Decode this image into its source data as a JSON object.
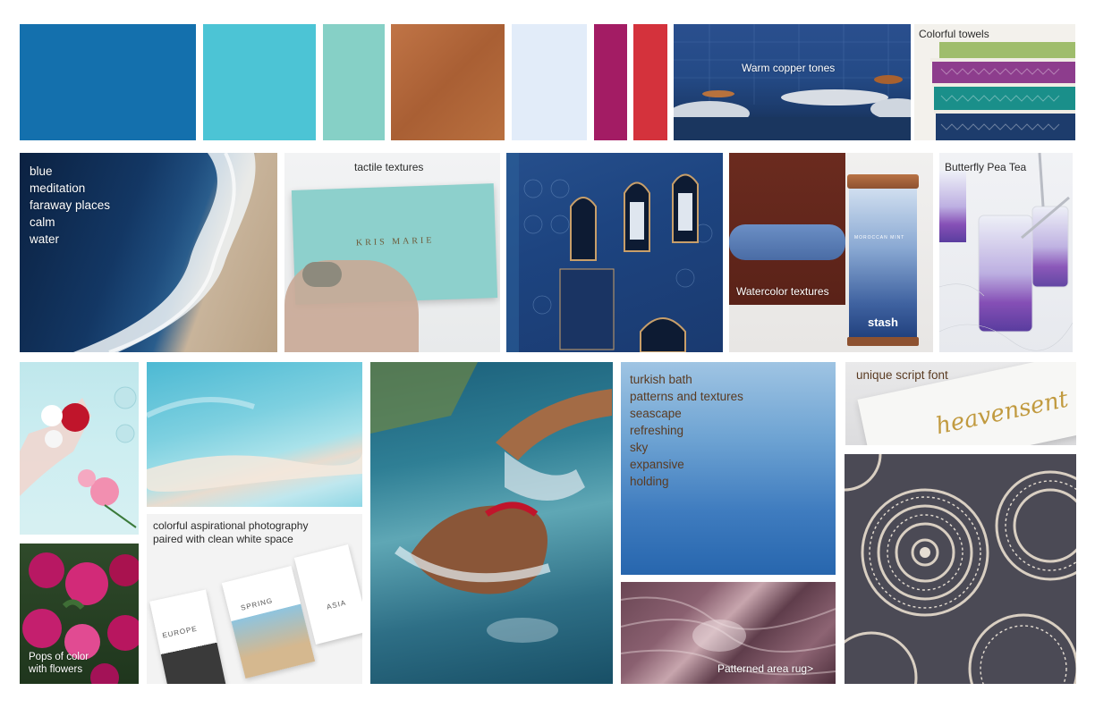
{
  "swatches": {
    "colors": [
      "#1470ad",
      "#4cc4d5",
      "#86d0c6",
      "#b46a3f",
      "#e2ecf9",
      "#a31c64",
      "#d4323c"
    ],
    "copper_label": "",
    "note": ""
  },
  "captions": {
    "warm_copper": "Warm copper tones",
    "colorful_towels": "Colorful towels",
    "ocean_words": [
      "blue",
      "meditation",
      "faraway places",
      "calm",
      "water"
    ],
    "tactile_textures": "tactile textures",
    "business_card_name": "KRIS MARIE",
    "watercolor_textures": "Watercolor textures",
    "tea_brand": "stash",
    "tea_tin_label": "MOROCCAN MINT",
    "butterfly_pea": "Butterfly Pea Tea",
    "pops_of_color": [
      "Pops of color",
      "with flowers"
    ],
    "aspirational": [
      "colorful aspirational photography",
      "paired with clean white space"
    ],
    "booklet_labels": [
      "EUROPE",
      "SPRING",
      "ASIA"
    ],
    "turkish_words": [
      "turkish bath",
      "patterns and textures",
      "seascape",
      "refreshing",
      "sky",
      "expansive",
      "holding"
    ],
    "script_font": "unique script font",
    "script_sample": "heavensent",
    "patterned_rug": "Patterned area rug>"
  },
  "icons": {
    "copper_bath": "bath-photo",
    "towels": "towel-stack-photo"
  }
}
